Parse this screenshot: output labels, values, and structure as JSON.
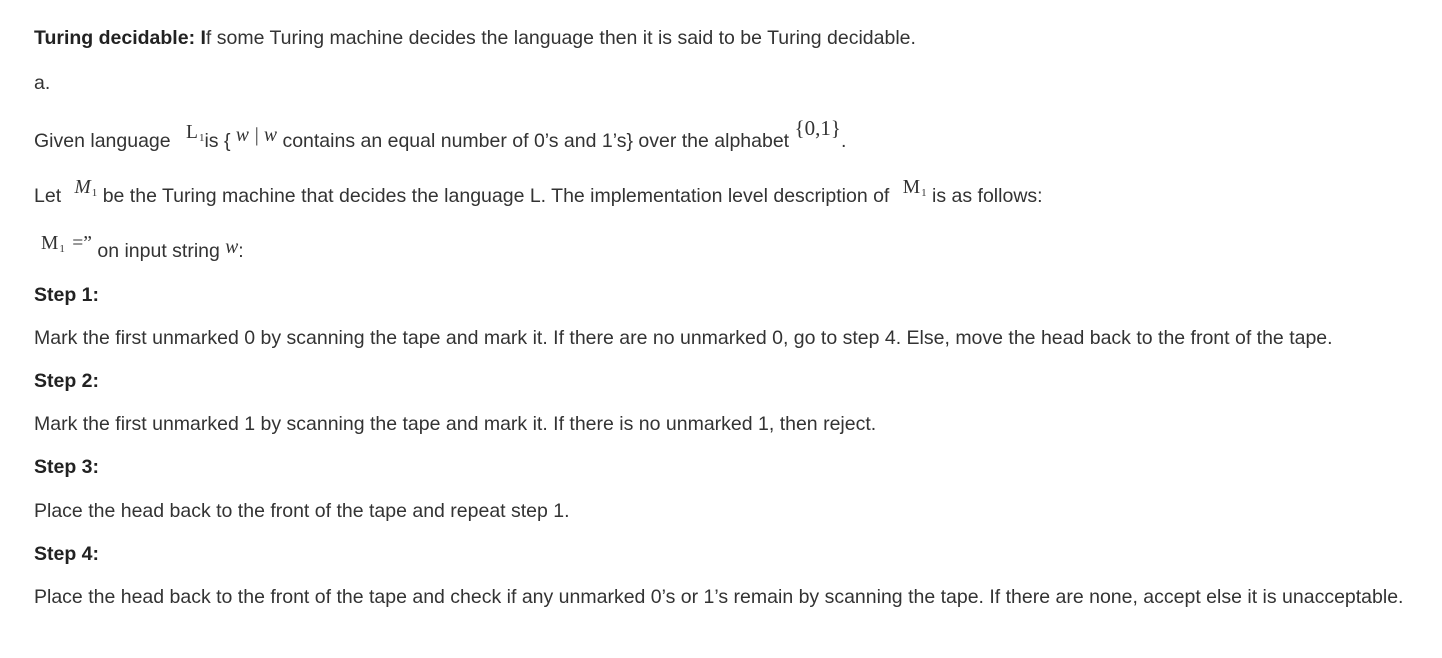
{
  "definition": {
    "term": "Turing decidable: I",
    "text": "f some Turing machine decides the language then it is said to be Turing decidable."
  },
  "part_label": "a.",
  "given": {
    "prefix": "Given language",
    "lang_symbol": "L",
    "lang_sub": "1",
    "is_text": "is {",
    "set_builder": "w | w",
    "condition": "contains an equal number of 0’s and 1’s} over the alphabet",
    "alphabet": "{0,1}",
    "end": "."
  },
  "let_line": {
    "prefix": "Let",
    "machine_symbol": "M",
    "machine_sub": "1",
    "middle": "be the Turing machine that decides the language L. The implementation level description of",
    "machine_symbol_2": "M",
    "machine_sub_2": "1",
    "suffix": "is as follows:"
  },
  "machine_def": {
    "symbol": "M",
    "sub": "1",
    "eq": "=”",
    "text": "on input string",
    "var": "w",
    "colon": ":"
  },
  "steps": [
    {
      "label": "Step 1:",
      "text": "Mark the first unmarked 0 by scanning the tape and mark it. If there are no unmarked 0, go to step 4. Else, move the head back to the front of the tape."
    },
    {
      "label": "Step 2:",
      "text": "Mark the first unmarked 1 by scanning the tape and mark it. If there is no unmarked 1, then reject."
    },
    {
      "label": "Step 3:",
      "text": "Place the head back to the front of the tape and repeat step 1."
    },
    {
      "label": "Step 4:",
      "text": "Place the head back to the front of the tape and check if any unmarked 0’s or 1’s remain by scanning the tape. If there are none, accept else it is unacceptable."
    }
  ]
}
